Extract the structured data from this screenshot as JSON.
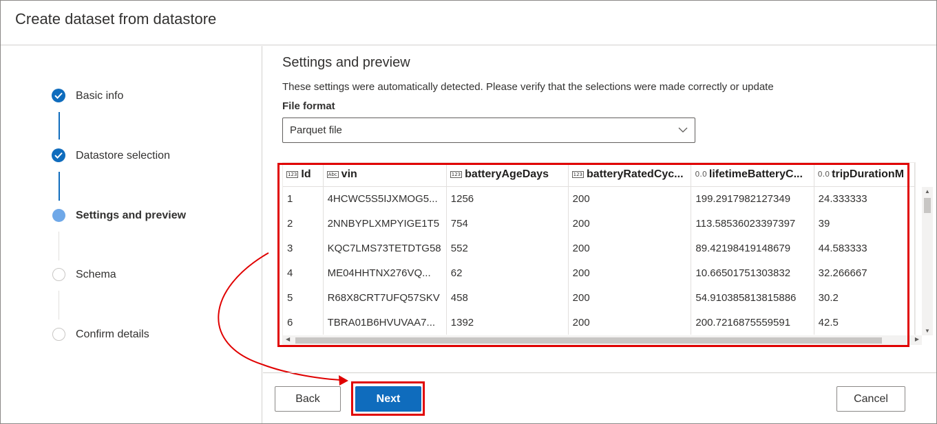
{
  "dialog": {
    "title": "Create dataset from datastore"
  },
  "steps": [
    {
      "label": "Basic info",
      "state": "done"
    },
    {
      "label": "Datastore selection",
      "state": "done"
    },
    {
      "label": "Settings and preview",
      "state": "current"
    },
    {
      "label": "Schema",
      "state": "todo"
    },
    {
      "label": "Confirm details",
      "state": "todo"
    }
  ],
  "settings": {
    "title": "Settings and preview",
    "description": "These settings were automatically detected. Please verify that the selections were made correctly or update",
    "file_format_label": "File format",
    "file_format_value": "Parquet file"
  },
  "preview": {
    "columns": [
      {
        "name": "Id",
        "type_icon": "123"
      },
      {
        "name": "vin",
        "type_icon": "Abc"
      },
      {
        "name": "batteryAgeDays",
        "type_icon": "123"
      },
      {
        "name": "batteryRatedCyc...",
        "type_icon": "123"
      },
      {
        "name": "lifetimeBatteryC...",
        "type_icon": "0.0"
      },
      {
        "name": "tripDurationM",
        "type_icon": "0.0"
      }
    ],
    "rows": [
      [
        "1",
        "4HCWC5S5IJXMOG5...",
        "1256",
        "200",
        "199.2917982127349",
        "24.333333"
      ],
      [
        "2",
        "2NNBYPLXMPYIGE1T5",
        "754",
        "200",
        "113.58536023397397",
        "39"
      ],
      [
        "3",
        "KQC7LMS73TETDTG58",
        "552",
        "200",
        "89.42198419148679",
        "44.583333"
      ],
      [
        "4",
        "ME04HHTNX276VQ...",
        "62",
        "200",
        "10.66501751303832",
        "32.266667"
      ],
      [
        "5",
        "R68X8CRT7UFQ57SKV",
        "458",
        "200",
        "54.910385813815886",
        "30.2"
      ],
      [
        "6",
        "TBRA01B6HVUVAA7...",
        "1392",
        "200",
        "200.7216875559591",
        "42.5"
      ]
    ]
  },
  "footer": {
    "back_label": "Back",
    "next_label": "Next",
    "cancel_label": "Cancel"
  },
  "colors": {
    "accent": "#0f6cbd",
    "highlight": "#e00000"
  }
}
